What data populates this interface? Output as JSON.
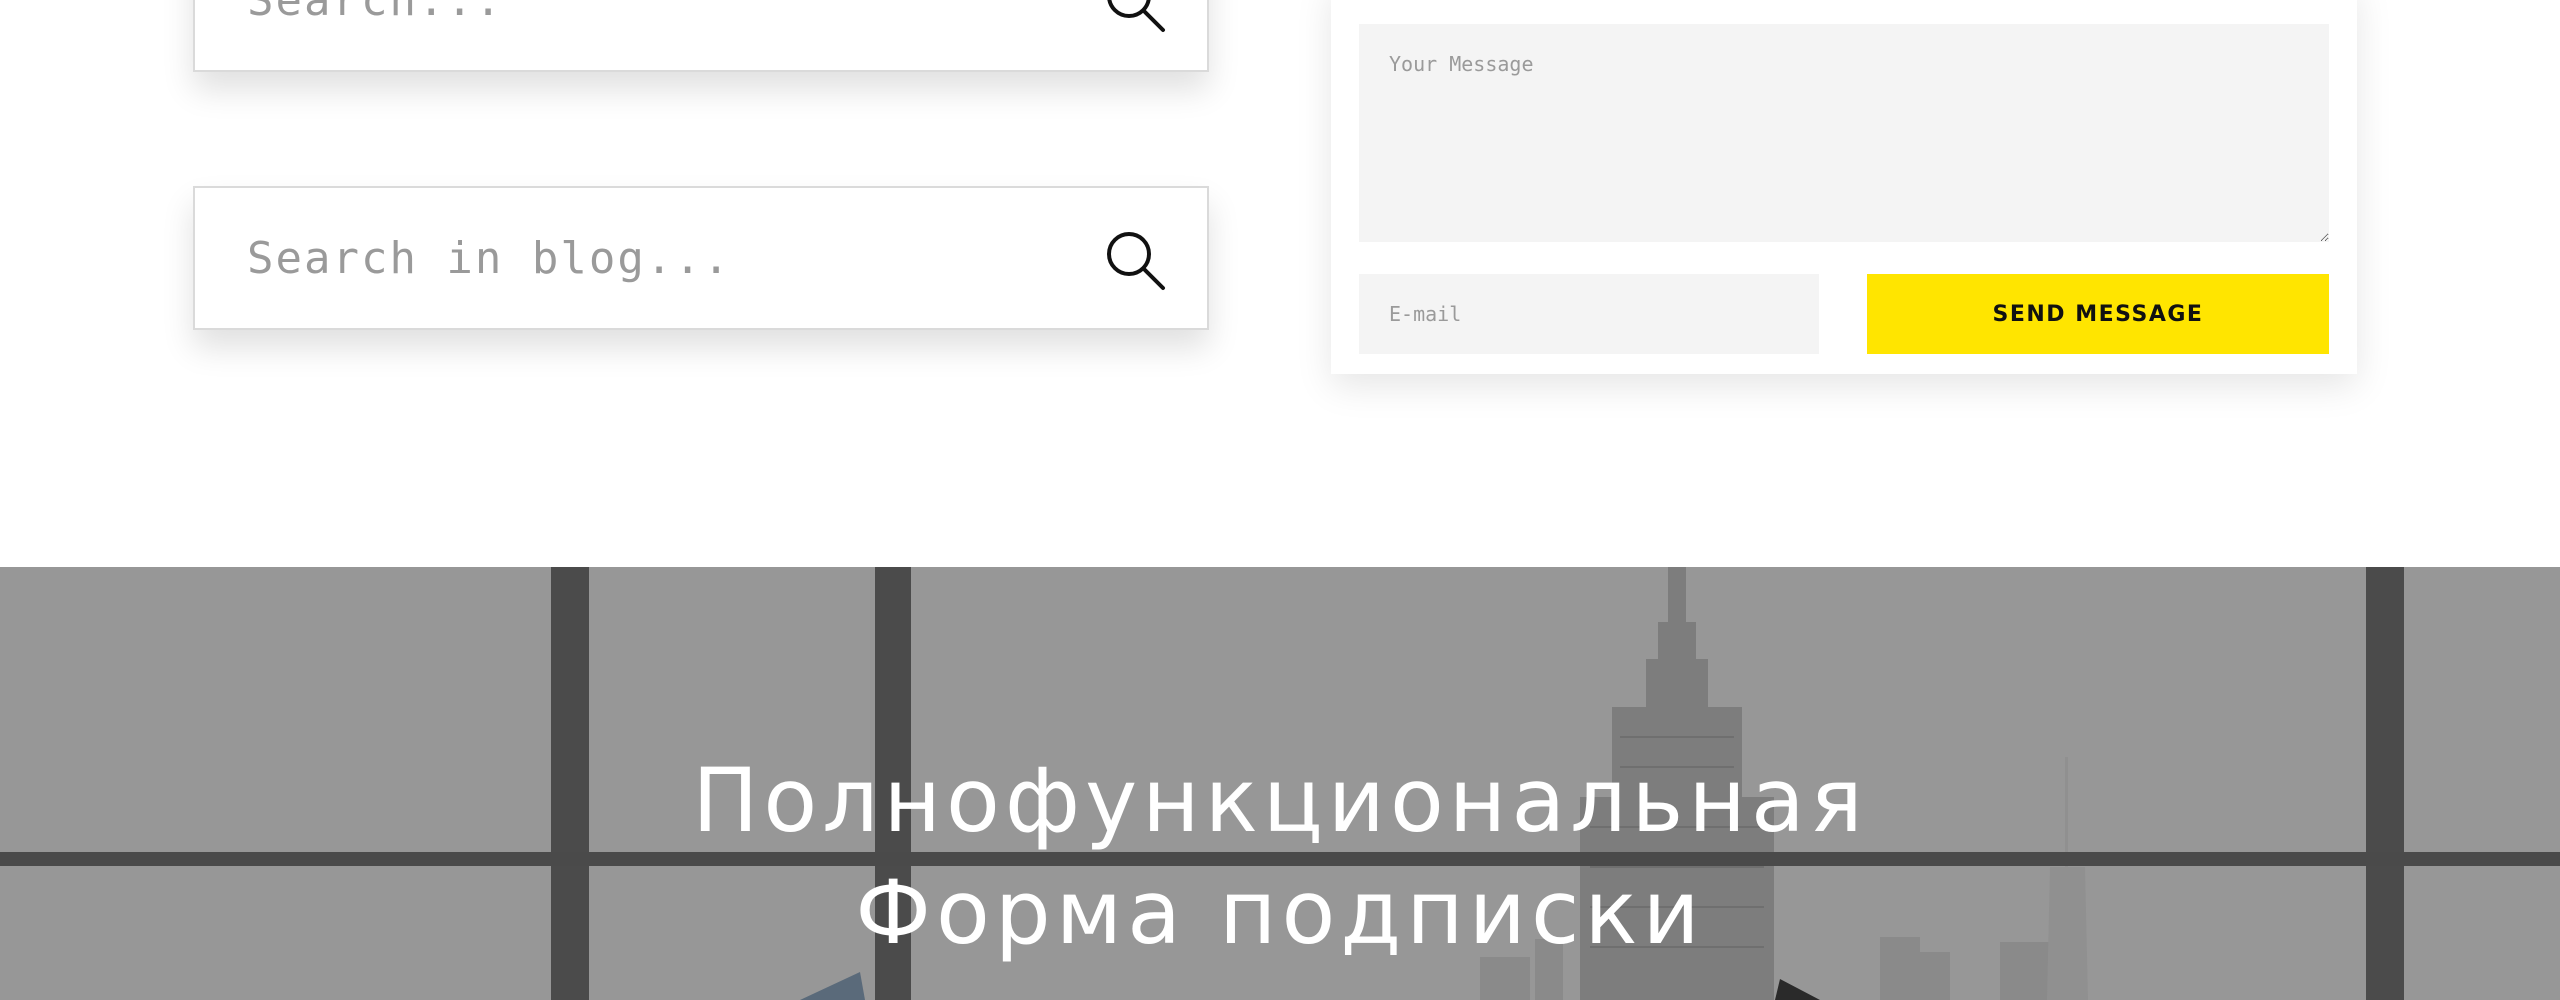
{
  "search_widgets": {
    "search_one": {
      "placeholder": "Search..."
    },
    "search_two": {
      "placeholder": "Search in blog..."
    }
  },
  "contact_form": {
    "message_placeholder": "Your Message",
    "email_placeholder": "E-mail",
    "send_label": "SEND MESSAGE",
    "accent_color": "#ffe500"
  },
  "hero": {
    "title_line1": "Полнофункциональная",
    "title_line2": "Форма подписки"
  },
  "icons": [
    "search-icon",
    "resize-handle-icon"
  ]
}
